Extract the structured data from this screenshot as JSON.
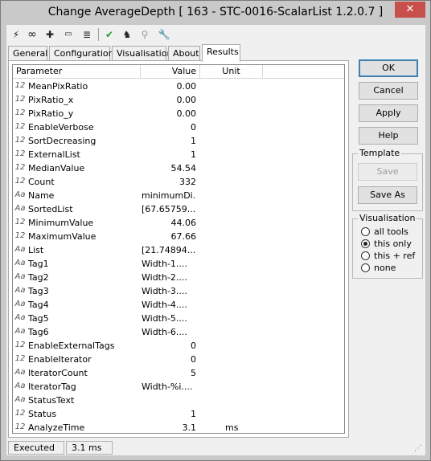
{
  "window": {
    "title": "Change AverageDepth [ 163 - STC-0016-ScalarList 1.2.0.7 ]",
    "close_label": "✕"
  },
  "toolbar": {
    "icons": [
      "lightning-icon",
      "link-icon",
      "puzzle-icon",
      "console-icon",
      "document-icon",
      "check-icon",
      "run-icon",
      "network-icon",
      "wrench-icon"
    ]
  },
  "tabs": [
    "General",
    "Configuration",
    "Visualisation",
    "About",
    "Results"
  ],
  "active_tab": "Results",
  "list": {
    "headers": [
      "Parameter",
      "Value",
      "Unit"
    ],
    "rows": [
      {
        "type": "12",
        "name": "MeanPixRatio",
        "value": "0.00",
        "unit": "",
        "numeric": true
      },
      {
        "type": "12",
        "name": "PixRatio_x",
        "value": "0.00",
        "unit": "",
        "numeric": true
      },
      {
        "type": "12",
        "name": "PixRatio_y",
        "value": "0.00",
        "unit": "",
        "numeric": true
      },
      {
        "type": "12",
        "name": "EnableVerbose",
        "value": "0",
        "unit": "",
        "numeric": true
      },
      {
        "type": "12",
        "name": "SortDecreasing",
        "value": "1",
        "unit": "",
        "numeric": true
      },
      {
        "type": "12",
        "name": "ExternalList",
        "value": "1",
        "unit": "",
        "numeric": true
      },
      {
        "type": "12",
        "name": "MedianValue",
        "value": "54.54",
        "unit": "",
        "numeric": true
      },
      {
        "type": "12",
        "name": "Count",
        "value": "332",
        "unit": "",
        "numeric": true
      },
      {
        "type": "Aa",
        "name": "Name",
        "value": "minimumDi...",
        "unit": "",
        "numeric": false
      },
      {
        "type": "Aa",
        "name": "SortedList",
        "value": "[67.65759...",
        "unit": "",
        "numeric": false
      },
      {
        "type": "12",
        "name": "MinimumValue",
        "value": "44.06",
        "unit": "",
        "numeric": true
      },
      {
        "type": "12",
        "name": "MaximumValue",
        "value": "67.66",
        "unit": "",
        "numeric": true
      },
      {
        "type": "Aa",
        "name": "List",
        "value": "[21.74894...",
        "unit": "",
        "numeric": false
      },
      {
        "type": "Aa",
        "name": "Tag1",
        "value": "Width-1....",
        "unit": "",
        "numeric": false
      },
      {
        "type": "Aa",
        "name": "Tag2",
        "value": "Width-2....",
        "unit": "",
        "numeric": false
      },
      {
        "type": "Aa",
        "name": "Tag3",
        "value": "Width-3....",
        "unit": "",
        "numeric": false
      },
      {
        "type": "Aa",
        "name": "Tag4",
        "value": "Width-4....",
        "unit": "",
        "numeric": false
      },
      {
        "type": "Aa",
        "name": "Tag5",
        "value": "Width-5....",
        "unit": "",
        "numeric": false
      },
      {
        "type": "Aa",
        "name": "Tag6",
        "value": "Width-6....",
        "unit": "",
        "numeric": false
      },
      {
        "type": "12",
        "name": "EnableExternalTags",
        "value": "0",
        "unit": "",
        "numeric": true
      },
      {
        "type": "12",
        "name": "EnableIterator",
        "value": "0",
        "unit": "",
        "numeric": true
      },
      {
        "type": "Aa",
        "name": "IteratorCount",
        "value": "5",
        "unit": "",
        "numeric": true
      },
      {
        "type": "Aa",
        "name": "IteratorTag",
        "value": "Width-%i....",
        "unit": "",
        "numeric": false
      },
      {
        "type": "Aa",
        "name": "StatusText",
        "value": "",
        "unit": "",
        "numeric": false
      },
      {
        "type": "12",
        "name": "Status",
        "value": "1",
        "unit": "",
        "numeric": true
      },
      {
        "type": "12",
        "name": "AnalyzeTime",
        "value": "3.1",
        "unit": "ms",
        "numeric": true
      }
    ]
  },
  "buttons": {
    "ok": "OK",
    "cancel": "Cancel",
    "apply": "Apply",
    "help": "Help"
  },
  "template": {
    "title": "Template",
    "save": "Save",
    "save_as": "Save As"
  },
  "visualisation": {
    "title": "Visualisation",
    "options": [
      "all tools",
      "this only",
      "this + ref",
      "none"
    ],
    "selected": "this only"
  },
  "status": {
    "state": "Executed",
    "time": "3.1 ms"
  }
}
